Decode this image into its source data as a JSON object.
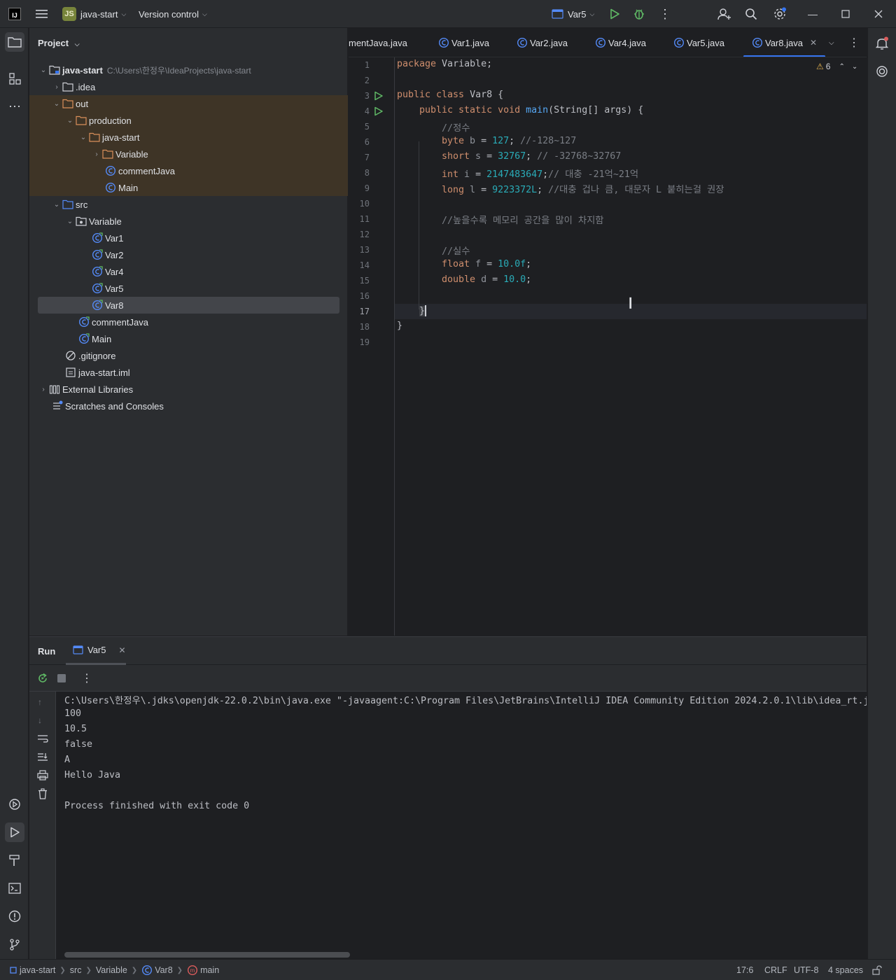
{
  "titlebar": {
    "project_badge": "JS",
    "project_name": "java-start",
    "vcs": "Version control",
    "run_config": "Var5"
  },
  "project_panel": {
    "title": "Project",
    "tree": [
      {
        "label": "java-start",
        "path": "C:\\Users\\한정우\\IdeaProjects\\java-start"
      },
      {
        "label": ".idea"
      },
      {
        "label": "out"
      },
      {
        "label": "production"
      },
      {
        "label": "java-start"
      },
      {
        "label": "Variable"
      },
      {
        "label": "commentJava"
      },
      {
        "label": "Main"
      },
      {
        "label": "src"
      },
      {
        "label": "Variable"
      },
      {
        "label": "Var1"
      },
      {
        "label": "Var2"
      },
      {
        "label": "Var4"
      },
      {
        "label": "Var5"
      },
      {
        "label": "Var8"
      },
      {
        "label": "commentJava"
      },
      {
        "label": "Main"
      },
      {
        "label": ".gitignore"
      },
      {
        "label": "java-start.iml"
      },
      {
        "label": "External Libraries"
      },
      {
        "label": "Scratches and Consoles"
      }
    ]
  },
  "editor": {
    "tabs": [
      "mentJava.java",
      "Var1.java",
      "Var2.java",
      "Var4.java",
      "Var5.java",
      "Var8.java"
    ],
    "warning_count": "6",
    "line_numbers": [
      "1",
      "2",
      "3",
      "4",
      "5",
      "6",
      "7",
      "8",
      "9",
      "10",
      "11",
      "12",
      "13",
      "14",
      "15",
      "16",
      "17",
      "18",
      "19"
    ],
    "lines": {
      "l1a": "package",
      "l1b": " Variable;",
      "l3a": "public class",
      "l3b": " Var8 {",
      "l4a": "public static void",
      "l4b": "main",
      "l4c": "(String[] args) {",
      "l5": "//정수",
      "l6a": "byte",
      "l6b": "b",
      "l6c": " = ",
      "l6d": "127",
      "l6e": "; ",
      "l6f": "//-128~127",
      "l7a": "short",
      "l7b": "s",
      "l7c": " = ",
      "l7d": "32767",
      "l7e": "; ",
      "l7f": "// -32768~32767",
      "l8a": "int",
      "l8b": "i",
      "l8c": " = ",
      "l8d": "2147483647",
      "l8e": ";",
      "l8f": "// 대충 -21억~21억",
      "l9a": "long",
      "l9b": "l",
      "l9c": " = ",
      "l9d": "9223372L",
      "l9e": "; ",
      "l9f": "//대충 겁나 큼, 대문자 L 붙히는걸 권장",
      "l11": "//높을수록 메모리 공간을 많이 차지함",
      "l13": "//실수",
      "l14a": "float",
      "l14b": "f",
      "l14c": " = ",
      "l14d": "10.0f",
      "l14e": ";",
      "l15a": "double",
      "l15b": "d",
      "l15c": " = ",
      "l15d": "10.0",
      "l15e": ";",
      "l17": "}",
      "l18": "}"
    }
  },
  "run_panel": {
    "title": "Run",
    "tab": "Var5",
    "output": [
      "C:\\Users\\한정우\\.jdks\\openjdk-22.0.2\\bin\\java.exe \"-javaagent:C:\\Program Files\\JetBrains\\IntelliJ IDEA Community Edition 2024.2.0.1\\lib\\idea_rt.j",
      "100",
      "10.5",
      "false",
      "A",
      "Hello Java",
      "",
      "Process finished with exit code 0"
    ]
  },
  "statusbar": {
    "crumbs": [
      "java-start",
      "src",
      "Variable",
      "Var8",
      "main"
    ],
    "position": "17:6",
    "line_sep": "CRLF",
    "encoding": "UTF-8",
    "indent": "4 spaces"
  },
  "colors": {
    "accent": "#3574f0",
    "run_green": "#5fb865",
    "keyword": "#cf8e6d",
    "number": "#2aacb8",
    "comment": "#7a7e85",
    "function": "#56a8f5"
  }
}
